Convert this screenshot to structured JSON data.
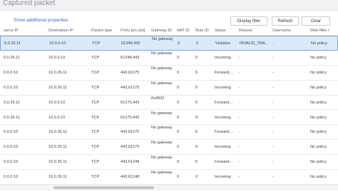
{
  "window": {
    "title": "Captured packet"
  },
  "toolbar": {
    "show_props_label": "Show additional properties",
    "display_filter_label": "Display filter",
    "refresh_label": "Refresh",
    "clear_label": "Clear"
  },
  "table": {
    "columns": [
      "ource IP",
      "Destination IP",
      "Packet type",
      "Ports [src,dst]",
      "Gateway ID",
      "NAT ID",
      "Rule ID",
      "Status",
      "Reason",
      "Username",
      "Web filter I"
    ],
    "rows": [
      {
        "src": "0.0.26.11",
        "dst": "10.0.0.10",
        "type": "TCP",
        "ports": "61248,443",
        "gateway": "No gateway",
        "nat": "0",
        "rule": "0",
        "status": "Violation",
        "reason": "INVALID_TRA...",
        "user": "-",
        "web": "No policy"
      },
      {
        "src": "0.0.26.11",
        "dst": "10.0.0.10",
        "type": "TCP",
        "ports": "61248,443",
        "gateway": "No gateway",
        "nat": "0",
        "rule": "0",
        "status": "Incoming",
        "reason": "-",
        "user": "-",
        "web": "No policy"
      },
      {
        "src": "0.0.0.10",
        "dst": "10.0.26.11",
        "type": "TCP",
        "ports": "443,61275",
        "gateway": "No gateway",
        "nat": "0",
        "rule": "6",
        "status": "Forward...",
        "reason": "-",
        "user": "-",
        "web": "No policy"
      },
      {
        "src": "0.0.0.10",
        "dst": "10.0.26.11",
        "type": "TCP",
        "ports": "443,61275",
        "gateway": "No gateway",
        "nat": "0",
        "rule": "0",
        "status": "Incoming",
        "reason": "-",
        "user": "-",
        "web": "No policy"
      },
      {
        "src": "0.0.26.11",
        "dst": "10.0.0.10",
        "type": "TCP",
        "ports": "61275,443",
        "gateway": "0x4002",
        "nat": "0",
        "rule": "6",
        "status": "Forward...",
        "reason": "-",
        "user": "-",
        "web": "No policy"
      },
      {
        "src": "0.0.26.11",
        "dst": "10.0.0.10",
        "type": "TCP",
        "ports": "61275,443",
        "gateway": "No gateway",
        "nat": "0",
        "rule": "0",
        "status": "Incoming",
        "reason": "-",
        "user": "-",
        "web": "No policy"
      },
      {
        "src": "0.0.0.10",
        "dst": "10.0.26.11",
        "type": "TCP",
        "ports": "443,61275",
        "gateway": "No gateway",
        "nat": "0",
        "rule": "6",
        "status": "Forward...",
        "reason": "-",
        "user": "-",
        "web": "No policy"
      },
      {
        "src": "0.0.0.10",
        "dst": "10.0.26.11",
        "type": "TCP",
        "ports": "443,61275",
        "gateway": "No gateway",
        "nat": "0",
        "rule": "0",
        "status": "Incoming",
        "reason": "-",
        "user": "-",
        "web": "No policy"
      },
      {
        "src": "0.0.0.10",
        "dst": "10.0.26.11",
        "type": "TCP",
        "ports": "443,61248",
        "gateway": "No gateway",
        "nat": "0",
        "rule": "6",
        "status": "Forward...",
        "reason": "-",
        "user": "-",
        "web": "No policy"
      },
      {
        "src": "0.0.0.10",
        "dst": "10.0.26.11",
        "type": "TCP",
        "ports": "443,61248",
        "gateway": "No gateway",
        "nat": "0",
        "rule": "0",
        "status": "Incoming",
        "reason": "-",
        "user": "-",
        "web": "No policy"
      }
    ]
  }
}
